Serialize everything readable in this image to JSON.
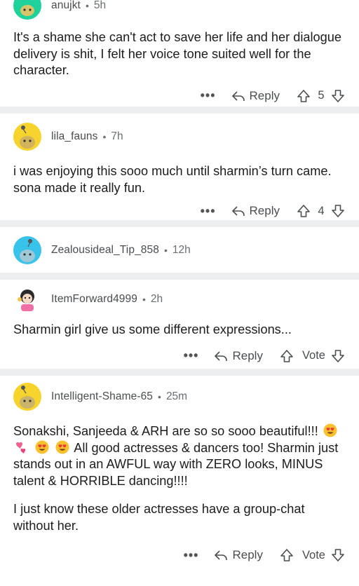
{
  "comments": [
    {
      "username": "anujkt",
      "time": "5h",
      "text": [
        "It's a shame she can't act to save her life and her dialogue delivery is shit, I felt her voice tone suited well for the character."
      ],
      "more": "•••",
      "reply": "Reply",
      "votes": "5"
    },
    {
      "username": "lila_fauns",
      "time": "7h",
      "text": [
        "i was enjoying this sooo much until sharmin’s turn came. sona made it really fun."
      ],
      "more": "•••",
      "reply": "Reply",
      "votes": "4"
    },
    {
      "username": "Zealousideal_Tip_858",
      "time": "12h"
    },
    {
      "username": "ItemForward4999",
      "time": "2h",
      "text": [
        "Sharmin girl give us some different expressions..."
      ],
      "more": "•••",
      "reply": "Reply",
      "votes": "Vote"
    },
    {
      "username": "Intelligent-Shame-65",
      "time": "25m",
      "text_a": "Sonakshi, Sanjeeda & ARH are so so sooo beautiful!!!",
      "text_b": "All good actresses & dancers too! Sharmin just stands out in an AWFUL way with ZERO looks, MINUS talent & HORRIBLE dancing!!!!",
      "emojis": [
        "heart-eyes-emoji",
        "two-hearts-emoji",
        "heart-eyes-emoji",
        "heart-eyes-emoji"
      ],
      "text2": "I just know these older actresses have a group-chat without her.",
      "more": "•••",
      "reply": "Reply",
      "votes": "Vote"
    }
  ],
  "colors": {
    "avatar_green": "#1fd19a",
    "avatar_yellow": "#f7d32e",
    "avatar_blue": "#37c3ea",
    "separator": "#eceef0"
  },
  "dot": "•"
}
